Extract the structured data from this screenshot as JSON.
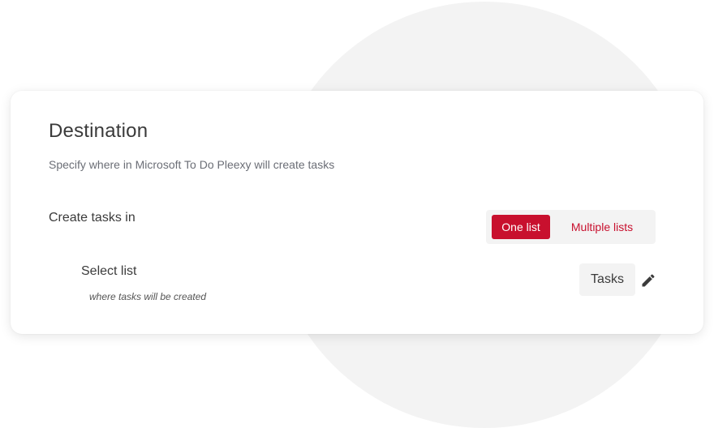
{
  "destination": {
    "title": "Destination",
    "subtitle": "Specify where in Microsoft To Do Pleexy will create tasks"
  },
  "create_tasks_in": {
    "label": "Create tasks in",
    "options": [
      "One list",
      "Multiple lists"
    ],
    "selected": "One list"
  },
  "select_list": {
    "label": "Select list",
    "hint": "where tasks will be created",
    "value": "Tasks",
    "edit_icon": "pencil-icon"
  },
  "colors": {
    "accent": "#c8102e",
    "background_circle": "#f3f3f3",
    "chip_background": "#f3f3f3"
  }
}
